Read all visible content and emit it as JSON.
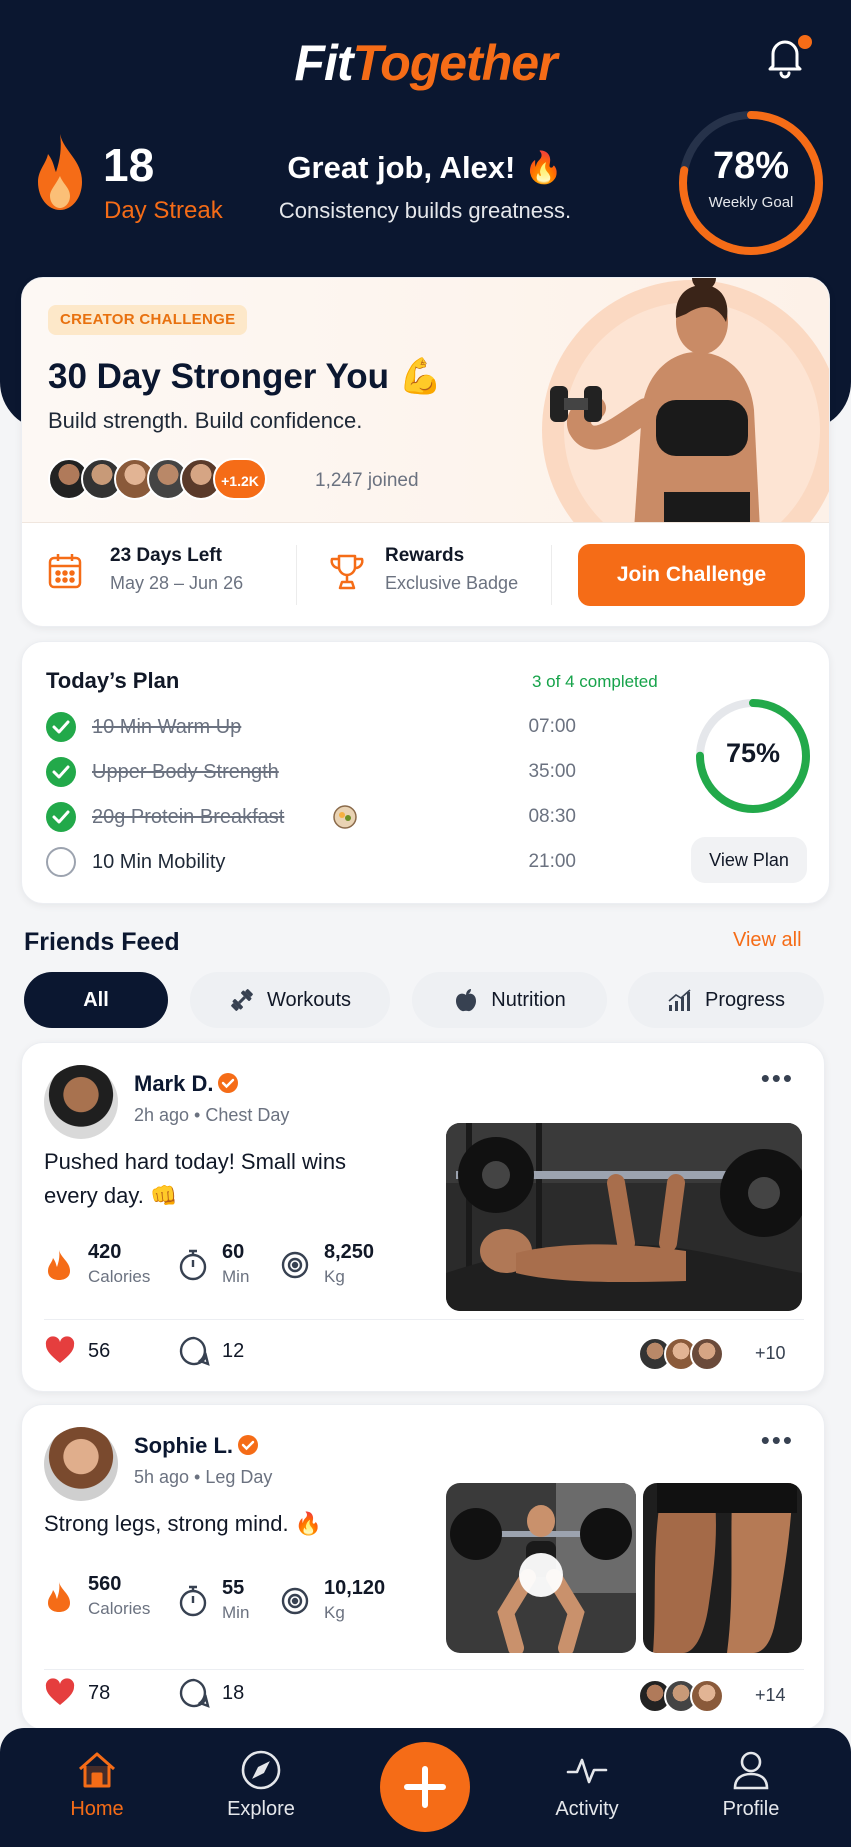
{
  "app": {
    "name_part1": "Fit",
    "name_part2": "Together",
    "accent": "#f56c17",
    "navy": "#0b1730"
  },
  "header": {
    "streak_value": "18",
    "streak_label": "Day Streak",
    "greeting": "Great job, Alex! 🔥",
    "greeting_sub": "Consistency builds greatness.",
    "goal_percent": "78%",
    "goal_label": "Weekly Goal",
    "goal_progress": 0.78,
    "notification_icon": "bell-icon"
  },
  "challenge": {
    "badge": "CREATOR CHALLENGE",
    "title": "30 Day Stronger You 💪",
    "subtitle": "Build strength. Build confidence.",
    "avatar_count": "+1.2K",
    "joined": "1,247 joined",
    "days_left": "23 Days Left",
    "date_range": "May 28 – Jun 26",
    "rewards_title": "Rewards",
    "rewards_sub": "Exclusive Badge",
    "join_label": "Join Challenge"
  },
  "plan": {
    "title": "Today’s Plan",
    "completed": "3 of 4 completed",
    "percent": "75%",
    "progress": 0.75,
    "view_plan": "View Plan",
    "tasks": [
      {
        "name": "10 Min Warm Up",
        "time": "07:00",
        "done": true
      },
      {
        "name": "Upper Body Strength",
        "time": "35:00",
        "done": true
      },
      {
        "name": "20g Protein Breakfast",
        "time": "08:30",
        "done": true
      },
      {
        "name": "10 Min Mobility",
        "time": "21:00",
        "done": false
      }
    ]
  },
  "feed": {
    "title": "Friends Feed",
    "view_all": "View all",
    "filters": [
      "All",
      "Workouts",
      "Nutrition",
      "Progress"
    ],
    "posts": [
      {
        "name": "Mark D.",
        "meta": "2h ago • Chest Day",
        "text": "Pushed hard today! Small wins every day. 👊",
        "calories": "420",
        "calories_label": "Calories",
        "minutes": "60",
        "minutes_label": "Min",
        "weight": "8,250",
        "weight_label": "Kg",
        "likes": "56",
        "comments": "12",
        "more": "+10"
      },
      {
        "name": "Sophie L.",
        "meta": "5h ago • Leg Day",
        "text": "Strong legs, strong mind. 🔥",
        "calories": "560",
        "calories_label": "Calories",
        "minutes": "55",
        "minutes_label": "Min",
        "weight": "10,120",
        "weight_label": "Kg",
        "likes": "78",
        "comments": "18",
        "more": "+14"
      }
    ]
  },
  "nav": {
    "home": "Home",
    "explore": "Explore",
    "activity": "Activity",
    "profile": "Profile"
  }
}
